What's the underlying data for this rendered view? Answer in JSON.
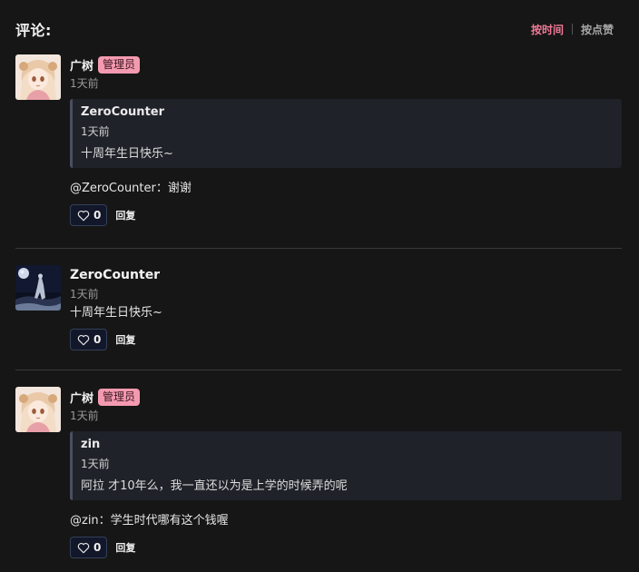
{
  "header": {
    "title": "评论:",
    "sort_by_time": "按时间",
    "sort_by_likes": "按点赞"
  },
  "comments": [
    {
      "user": "广树",
      "badge": "管理员",
      "time": "1天前",
      "quote": {
        "user": "ZeroCounter",
        "time": "1天前",
        "text": "十周年生日快乐~"
      },
      "text": "@ZeroCounter：谢谢",
      "likes": "0",
      "reply_label": "回复"
    },
    {
      "user": "ZeroCounter",
      "time": "1天前",
      "text": "十周年生日快乐~",
      "likes": "0",
      "reply_label": "回复"
    },
    {
      "user": "广树",
      "badge": "管理员",
      "time": "1天前",
      "quote": {
        "user": "zin",
        "time": "1天前",
        "text": "阿拉 才10年么，我一直还以为是上学的时候弄的呢"
      },
      "text": "@zin：学生时代哪有这个钱喔",
      "likes": "0",
      "reply_label": "回复"
    }
  ],
  "colors": {
    "background": "#161616",
    "accent": "#f07a96",
    "badge": "#f49ab0",
    "quote_bg": "#1f2229"
  },
  "icons": {
    "like": "heart-icon"
  }
}
